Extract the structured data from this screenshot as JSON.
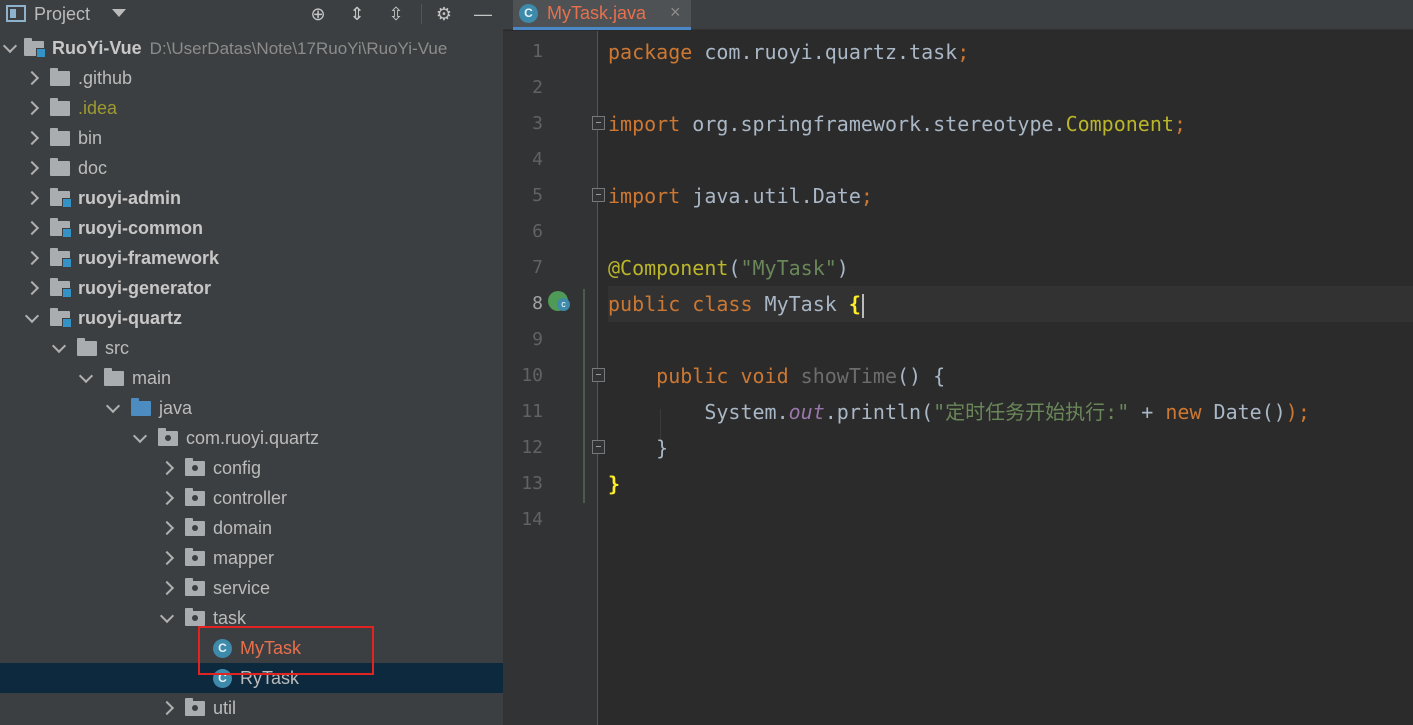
{
  "project_panel": {
    "title": "Project",
    "root": {
      "name": "RuoYi-Vue",
      "path": "D:\\UserDatas\\Note\\17RuoYi\\RuoYi-Vue"
    },
    "items": [
      {
        "label": ".github"
      },
      {
        "label": ".idea"
      },
      {
        "label": "bin"
      },
      {
        "label": "doc"
      },
      {
        "label": "ruoyi-admin"
      },
      {
        "label": "ruoyi-common"
      },
      {
        "label": "ruoyi-framework"
      },
      {
        "label": "ruoyi-generator"
      },
      {
        "label": "ruoyi-quartz"
      },
      {
        "label": "src"
      },
      {
        "label": "main"
      },
      {
        "label": "java"
      },
      {
        "label": "com.ruoyi.quartz"
      },
      {
        "label": "config"
      },
      {
        "label": "controller"
      },
      {
        "label": "domain"
      },
      {
        "label": "mapper"
      },
      {
        "label": "service"
      },
      {
        "label": "task"
      },
      {
        "label": "MyTask"
      },
      {
        "label": "RyTask"
      },
      {
        "label": "util"
      }
    ]
  },
  "editor": {
    "tab": {
      "label": "MyTask.java",
      "close": "×"
    },
    "class_icon_letter": "C",
    "line_numbers": [
      "1",
      "2",
      "3",
      "4",
      "5",
      "6",
      "7",
      "8",
      "9",
      "10",
      "11",
      "12",
      "13",
      "14"
    ],
    "current_line": 8,
    "code": {
      "l1_kw": "package",
      "l1_rest": " com.ruoyi.quartz.task",
      "l1_semi": ";",
      "l3_kw": "import",
      "l3_pkg": " org.springframework.stereotype.",
      "l3_cls": "Component",
      "l3_semi": ";",
      "l5_kw": "import",
      "l5_rest": " java.util.Date",
      "l5_semi": ";",
      "l7_ann": "@Component",
      "l7_open": "(",
      "l7_str": "\"MyTask\"",
      "l7_close": ")",
      "l8_kw": "public class",
      "l8_name": " MyTask ",
      "l8_brace": "{",
      "l10_kw": "public void",
      "l10_method": "showTime",
      "l10_rest": "() {",
      "l11_obj": "System.",
      "l11_field": "out",
      "l11_call": ".println(",
      "l11_str": "\"定时任务开始执行:\"",
      "l11_plus": " + ",
      "l11_new": "new",
      "l11_rest": " Date()",
      "l11_semi": ");",
      "l12": "}",
      "l13": "}"
    }
  },
  "colors": {
    "keyword": "#cc7832",
    "annotation": "#bbb529",
    "string": "#6a8759",
    "field": "#9876aa",
    "selected_row": "#0d293e",
    "highlight_box": "#e32222"
  }
}
